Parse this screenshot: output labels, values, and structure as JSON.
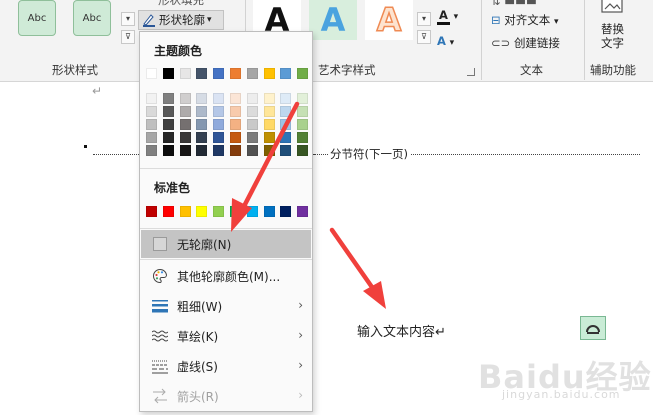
{
  "ribbon": {
    "shape_style_buttons": [
      "Abc",
      "Abc"
    ],
    "partial_label": "形状填充",
    "shape_outline_label": "形状轮廓",
    "group_shape_style": "形状样式",
    "group_art_style": "艺术字样式",
    "group_text": "文本",
    "group_aux": "辅助功能",
    "art_letters": [
      "A",
      "A",
      "A"
    ],
    "align_text_label": "对齐文本",
    "create_link_label": "创建链接",
    "replace_text_line1": "替换",
    "replace_text_line2": "文字"
  },
  "dropdown": {
    "theme_colors_heading": "主题颜色",
    "theme_colors": [
      "#ffffff",
      "#000000",
      "#e7e6e6",
      "#44546a",
      "#4472c4",
      "#ed7d31",
      "#a5a5a5",
      "#ffc000",
      "#5b9bd5",
      "#70ad47"
    ],
    "theme_shades": [
      [
        "#f2f2f2",
        "#d9d9d9",
        "#bfbfbf",
        "#a6a6a6",
        "#808080"
      ],
      [
        "#808080",
        "#595959",
        "#404040",
        "#262626",
        "#0d0d0d"
      ],
      [
        "#d0cece",
        "#aeabab",
        "#757070",
        "#3a3838",
        "#171616"
      ],
      [
        "#d6dce5",
        "#adb9ca",
        "#8497b0",
        "#333f50",
        "#222a35"
      ],
      [
        "#dae3f3",
        "#b4c7e7",
        "#8faadc",
        "#2f5597",
        "#1f3864"
      ],
      [
        "#fbe5d6",
        "#f8cbad",
        "#f4b183",
        "#c55a11",
        "#843c0c"
      ],
      [
        "#ededed",
        "#dbdbdb",
        "#c9c9c9",
        "#7b7b7b",
        "#525252"
      ],
      [
        "#fff2cc",
        "#ffe699",
        "#ffd966",
        "#bf9000",
        "#7f6000"
      ],
      [
        "#deebf7",
        "#bdd7ee",
        "#9dc3e6",
        "#2e75b6",
        "#1f4e79"
      ],
      [
        "#e2f0d9",
        "#c5e0b4",
        "#a9d18e",
        "#538135",
        "#375623"
      ]
    ],
    "standard_colors_heading": "标准色",
    "standard_colors": [
      "#c00000",
      "#ff0000",
      "#ffc000",
      "#ffff00",
      "#92d050",
      "#00b050",
      "#00b0f0",
      "#0070c0",
      "#002060",
      "#7030a0"
    ],
    "items": {
      "no_outline": "无轮廓(N)",
      "more_colors": "其他轮廓颜色(M)...",
      "weight": "粗细(W)",
      "sketch": "草绘(K)",
      "dashes": "虚线(S)",
      "arrows": "箭头(R)"
    }
  },
  "document": {
    "section_break": "分节符(下一页)",
    "body_text": "输入文本内容↵",
    "para_mark": "↵"
  },
  "watermark": {
    "main": "Baidu经验",
    "sub": "jingyan.baidu.com"
  },
  "colors": {
    "annotation_arrow": "#f0403c",
    "hover_bg": "#c4c4c4"
  }
}
